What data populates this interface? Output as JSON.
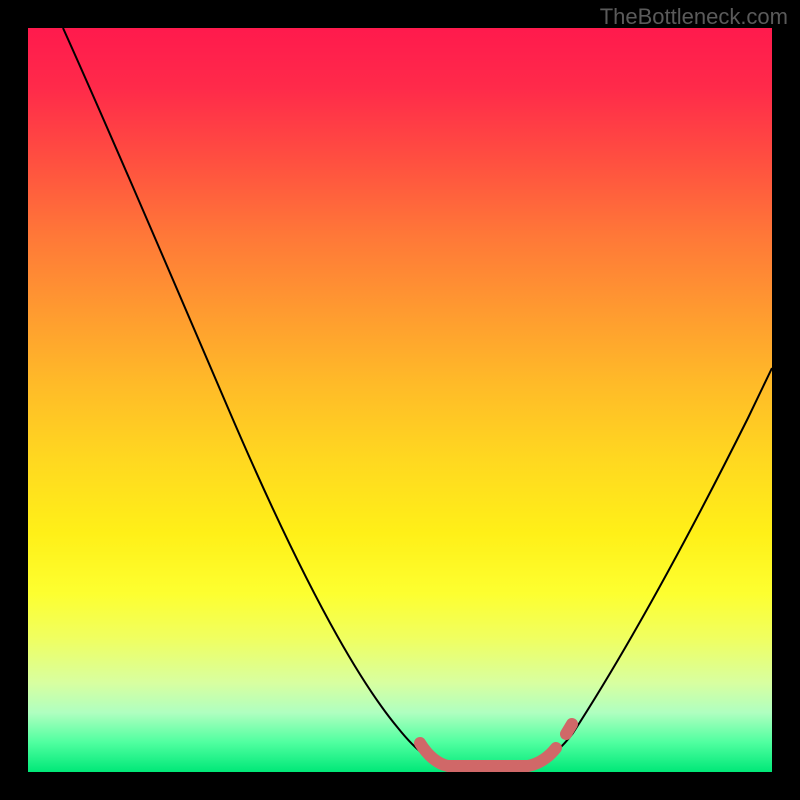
{
  "watermark": "TheBottleneck.com",
  "chart_data": {
    "type": "line",
    "title": "",
    "xlabel": "",
    "ylabel": "",
    "xlim": [
      0,
      100
    ],
    "ylim": [
      0,
      100
    ],
    "series": [
      {
        "name": "bottleneck-curve",
        "x": [
          5,
          10,
          15,
          20,
          25,
          30,
          35,
          40,
          45,
          50,
          54,
          58,
          62,
          66,
          70,
          74,
          78,
          82,
          86,
          90,
          94,
          98,
          100
        ],
        "y": [
          100,
          90,
          80,
          70,
          60,
          50,
          40,
          30,
          20,
          12,
          6,
          2,
          0.5,
          0.2,
          0.5,
          2,
          6,
          12,
          20,
          30,
          40,
          50,
          55
        ]
      }
    ],
    "markers": {
      "name": "highlight-band",
      "x_range": [
        53,
        72
      ],
      "y": 0.5,
      "color": "#d06868"
    },
    "background": {
      "type": "vertical-gradient",
      "stops": [
        {
          "pos": 0,
          "color": "#ff1a4d"
        },
        {
          "pos": 50,
          "color": "#ffd820"
        },
        {
          "pos": 80,
          "color": "#fdff30"
        },
        {
          "pos": 100,
          "color": "#00e878"
        }
      ]
    },
    "grid": false,
    "legend": false
  }
}
